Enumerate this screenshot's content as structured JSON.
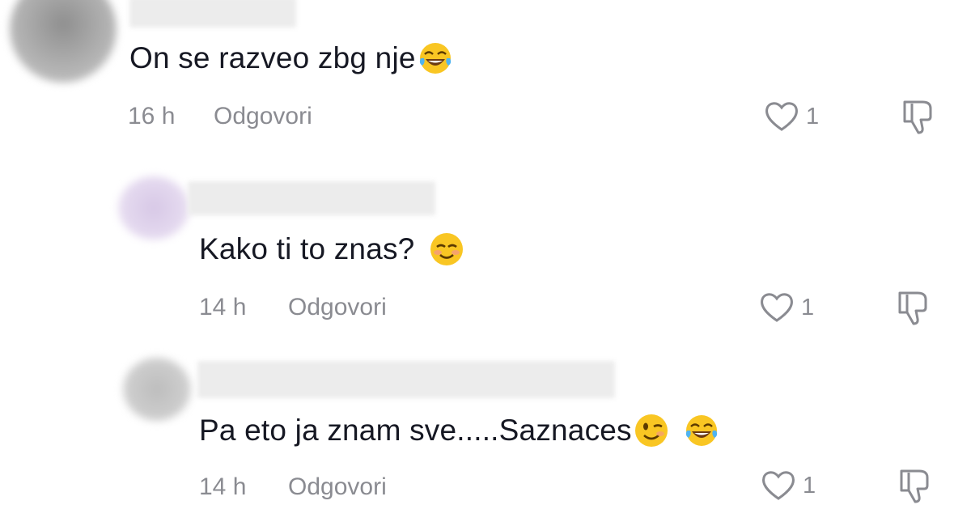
{
  "comments": [
    {
      "text": "On se razveo zbg nje",
      "emojis": [
        "face-with-tears-of-joy-icon"
      ],
      "time": "16 h",
      "reply_label": "Odgovori",
      "likes": "1"
    },
    {
      "text": "Kako ti to znas?",
      "emojis": [
        "smiling-face-icon"
      ],
      "time": "14 h",
      "reply_label": "Odgovori",
      "likes": "1"
    },
    {
      "text": "Pa eto ja znam sve.....Saznaces",
      "emojis": [
        "winking-face-icon",
        "face-with-tears-of-joy-icon"
      ],
      "time": "14 h",
      "reply_label": "Odgovori",
      "likes": "1"
    }
  ],
  "colors": {
    "text": "#161823",
    "secondary": "#8a8b91"
  }
}
